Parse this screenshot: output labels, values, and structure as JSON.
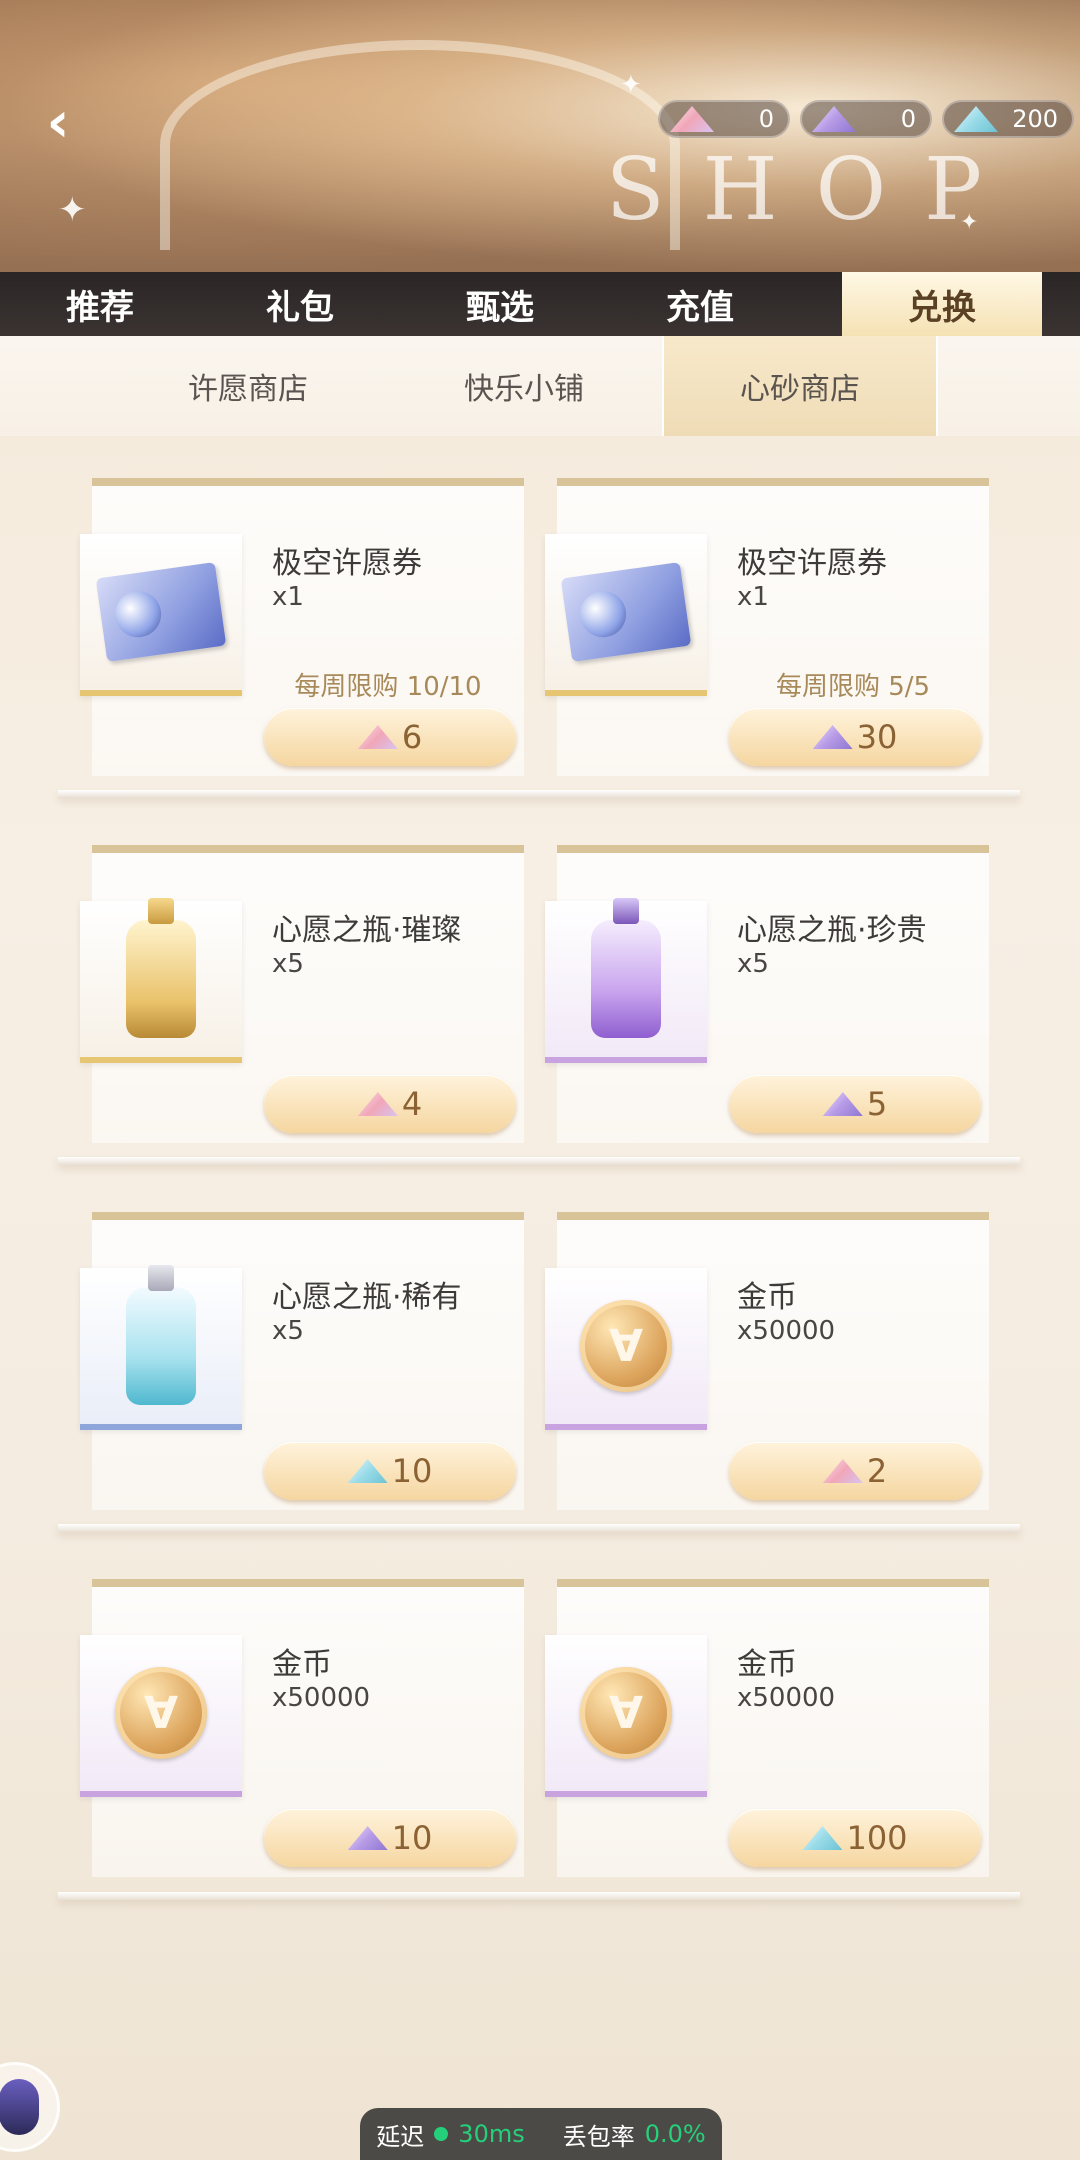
{
  "currencies": [
    {
      "icon": "pink-gem-icon",
      "value": "0"
    },
    {
      "icon": "purple-gem-icon",
      "value": "0"
    },
    {
      "icon": "cyan-gem-icon",
      "value": "200"
    }
  ],
  "banner": {
    "letters": "SHOP"
  },
  "tabs": [
    "推荐",
    "礼包",
    "甄选",
    "充值",
    "兑换"
  ],
  "subtabs": [
    "许愿商店",
    "快乐小铺",
    "心砂商店"
  ],
  "items": [
    {
      "name": "极空许愿券",
      "qty": "x1",
      "limit": "每周限购 10/10",
      "price": "6",
      "gem": "pink",
      "art": "ticket"
    },
    {
      "name": "极空许愿券",
      "qty": "x1",
      "limit": "每周限购 5/5",
      "price": "30",
      "gem": "purple",
      "art": "ticket"
    },
    {
      "name": "心愿之瓶·璀璨",
      "qty": "x5",
      "limit": "",
      "price": "4",
      "gem": "pink",
      "art": "bottle-gold"
    },
    {
      "name": "心愿之瓶·珍贵",
      "qty": "x5",
      "limit": "",
      "price": "5",
      "gem": "purple",
      "art": "bottle-purple"
    },
    {
      "name": "心愿之瓶·稀有",
      "qty": "x5",
      "limit": "",
      "price": "10",
      "gem": "cyan",
      "art": "bottle-cyan"
    },
    {
      "name": "金币",
      "qty": "x50000",
      "limit": "",
      "price": "2",
      "gem": "pink",
      "art": "coin"
    },
    {
      "name": "金币",
      "qty": "x50000",
      "limit": "",
      "price": "10",
      "gem": "purple",
      "art": "coin"
    },
    {
      "name": "金币",
      "qty": "x50000",
      "limit": "",
      "price": "100",
      "gem": "cyan",
      "art": "coin"
    }
  ],
  "network": {
    "latency_label": "延迟",
    "latency_value": "30ms",
    "loss_label": "丢包率",
    "loss_value": "0.0%"
  }
}
